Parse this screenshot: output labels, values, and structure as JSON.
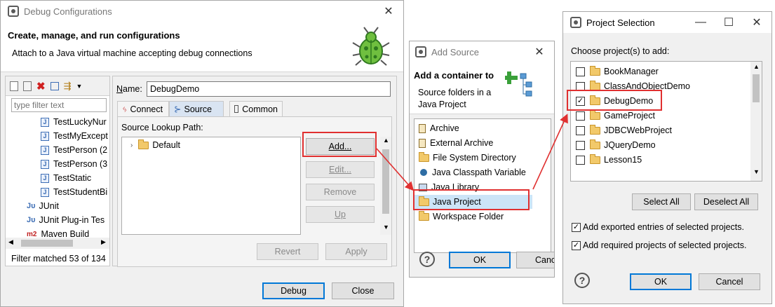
{
  "debug": {
    "title": "Debug Configurations",
    "header_title": "Create, manage, and run configurations",
    "header_sub": "Attach to a Java virtual machine accepting debug connections",
    "filter_placeholder": "type filter text",
    "tree_items": [
      "TestLuckyNur",
      "TestMyExcept",
      "TestPerson (2",
      "TestPerson (3",
      "TestStatic",
      "TestStudentBi",
      "JUnit",
      "JUnit Plug-in Tes",
      "Maven Build"
    ],
    "filter_status": "Filter matched 53 of 134",
    "name_label": "Name:",
    "name_value": "DebugDemo",
    "tabs": [
      "Connect",
      "Source",
      "Common"
    ],
    "lookup_label": "Source Lookup Path:",
    "default_item": "Default",
    "buttons": {
      "add": "Add...",
      "edit": "Edit...",
      "remove": "Remove",
      "up": "Up"
    },
    "revert": "Revert",
    "apply": "Apply",
    "debug_btn": "Debug",
    "close_btn": "Close"
  },
  "add_source": {
    "title": "Add Source",
    "header_title": "Add a container to",
    "header_sub_1": "Source folders in a",
    "header_sub_2": "Java Project",
    "items": [
      "Archive",
      "External Archive",
      "File System Directory",
      "Java Classpath Variable",
      "Java Library",
      "Java Project",
      "Workspace Folder"
    ],
    "ok": "OK",
    "cancel": "Canc"
  },
  "project_selection": {
    "title": "Project Selection",
    "choose_label": "Choose project(s) to add:",
    "projects": [
      {
        "name": "BookManager",
        "checked": false
      },
      {
        "name": "ClassAndObjectDemo",
        "checked": false
      },
      {
        "name": "DebugDemo",
        "checked": true
      },
      {
        "name": "GameProject",
        "checked": false
      },
      {
        "name": "JDBCWebProject",
        "checked": false
      },
      {
        "name": "JQueryDemo",
        "checked": false
      },
      {
        "name": "Lesson15",
        "checked": false
      }
    ],
    "select_all": "Select All",
    "deselect_all": "Deselect All",
    "opt_exported": "Add exported entries of selected projects.",
    "opt_required": "Add required projects of selected projects.",
    "ok": "OK",
    "cancel": "Cancel"
  },
  "colors": {
    "highlight": "#e03030",
    "accent": "#0078d7"
  }
}
